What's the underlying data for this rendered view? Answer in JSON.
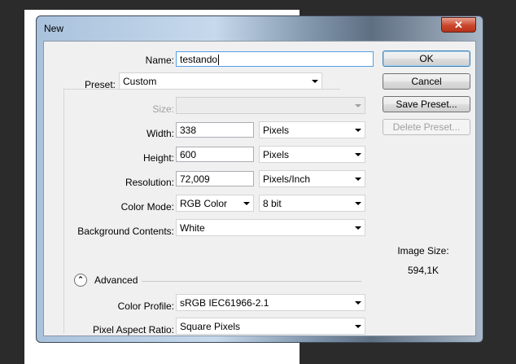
{
  "dialog": {
    "title": "New",
    "close_glyph": "✕"
  },
  "form": {
    "name_label": "Name:",
    "name_value": "testando",
    "preset_label": "Preset:",
    "preset_value": "Custom",
    "size_label": "Size:",
    "size_value": "",
    "width_label": "Width:",
    "width_value": "338",
    "width_unit": "Pixels",
    "height_label": "Height:",
    "height_value": "600",
    "height_unit": "Pixels",
    "resolution_label": "Resolution:",
    "resolution_value": "72,009",
    "resolution_unit": "Pixels/Inch",
    "color_mode_label": "Color Mode:",
    "color_mode_value": "RGB Color",
    "bit_depth_value": "8 bit",
    "background_label": "Background Contents:",
    "background_value": "White",
    "advanced_label": "Advanced",
    "advanced_glyph": "⌃",
    "color_profile_label": "Color Profile:",
    "color_profile_value": "sRGB IEC61966-2.1",
    "pixel_aspect_label": "Pixel Aspect Ratio:",
    "pixel_aspect_value": "Square Pixels"
  },
  "buttons": {
    "ok": "OK",
    "cancel": "Cancel",
    "save_preset": "Save Preset...",
    "delete_preset": "Delete Preset..."
  },
  "image_size": {
    "label": "Image Size:",
    "value": "594,1K"
  }
}
